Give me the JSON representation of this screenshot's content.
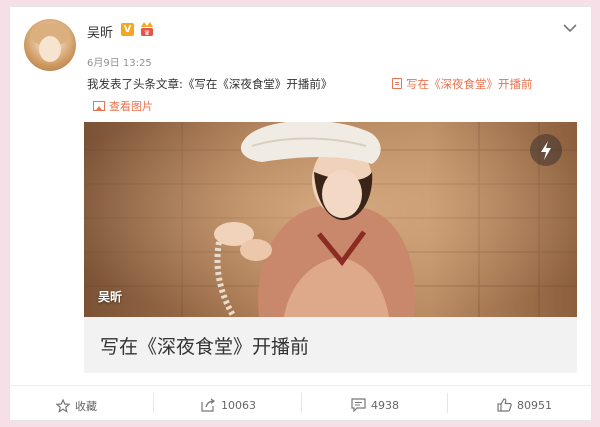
{
  "post": {
    "username": "吴昕",
    "verified_badge": "V",
    "timestamp": "6月9日 13:25",
    "text": "我发表了头条文章:《写在《深夜食堂》开播前》",
    "link_text": "写在《深夜食堂》开播前",
    "view_images_label": "查看图片"
  },
  "article": {
    "cover_label": "吴昕",
    "title": "写在《深夜食堂》开播前"
  },
  "actions": {
    "favorite_label": "收藏",
    "repost_count": "10063",
    "comment_count": "4938",
    "like_count": "80951"
  },
  "colors": {
    "accent": "#eb7350",
    "page_background": "#f6dfe6",
    "verified": "#f5a623"
  },
  "icons": {
    "favorite": "star-icon",
    "repost": "repost-icon",
    "comment": "comment-icon",
    "like": "thumbs-up-icon",
    "menu": "chevron-down-icon",
    "cover_action": "lightning-icon"
  }
}
